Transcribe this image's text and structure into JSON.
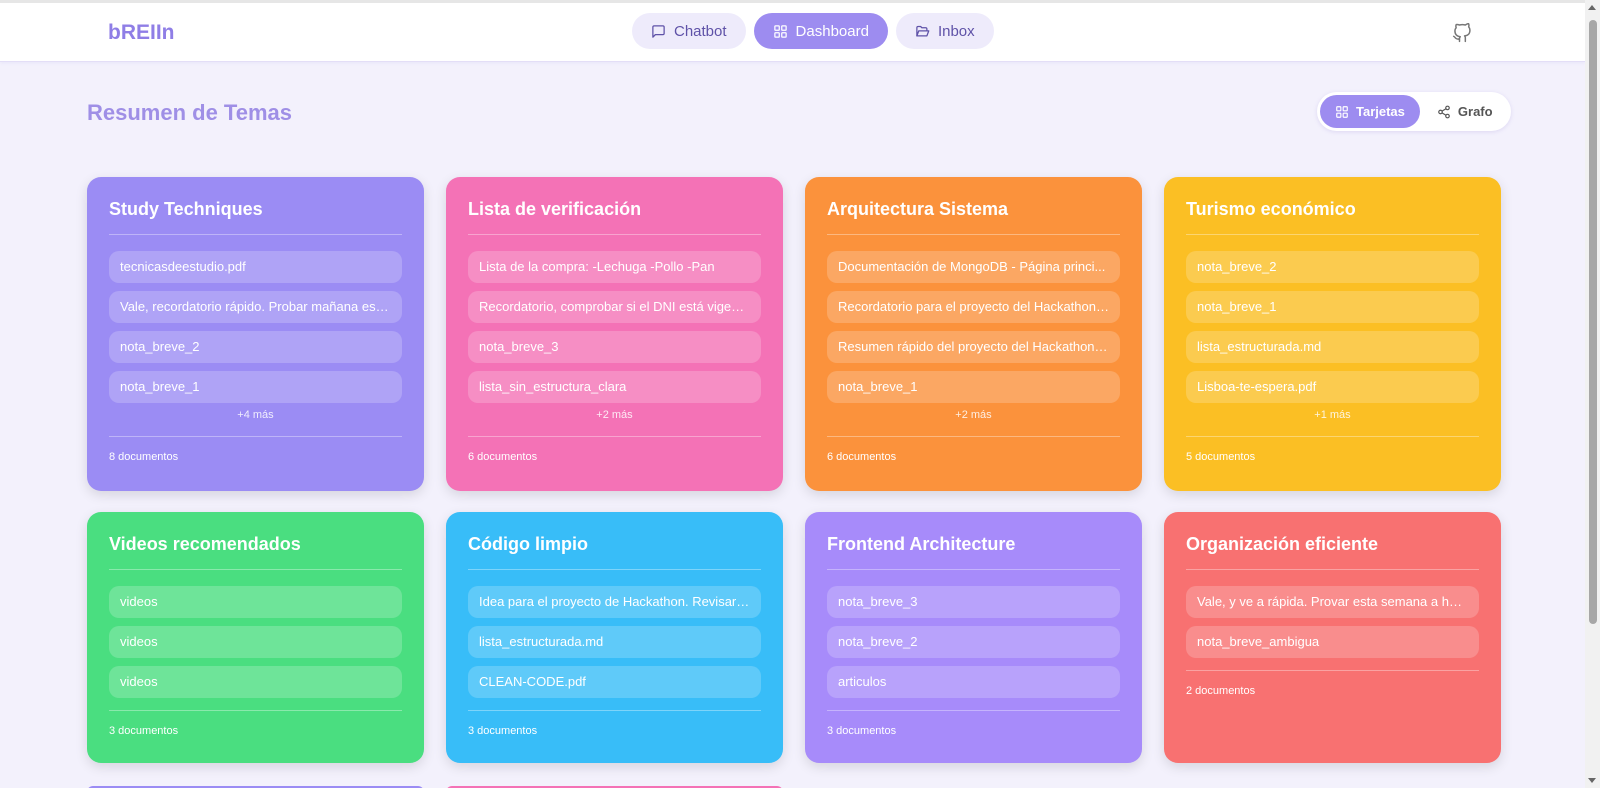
{
  "header": {
    "logo": "bREIIn",
    "nav": [
      {
        "label": "Chatbot",
        "icon": "message-square-icon",
        "active": false
      },
      {
        "label": "Dashboard",
        "icon": "layout-grid-icon",
        "active": true
      },
      {
        "label": "Inbox",
        "icon": "folder-open-icon",
        "active": false
      }
    ],
    "github_icon": "github-icon"
  },
  "page": {
    "title": "Resumen de Temas",
    "views": [
      {
        "label": "Tarjetas",
        "icon": "layout-grid-icon",
        "active": true
      },
      {
        "label": "Grafo",
        "icon": "share-icon",
        "active": false
      }
    ]
  },
  "cards": [
    {
      "title": "Study Techniques",
      "color": "#9b8cf4",
      "items": [
        "tecnicasdeestudio.pdf",
        "Vale, recordatorio rápido. Probar mañana estu...",
        "nota_breve_2",
        "nota_breve_1"
      ],
      "more": "+4 más",
      "count": "8 documentos"
    },
    {
      "title": "Lista de verificación",
      "color": "#f472b6",
      "items": [
        "Lista de la compra: -Lechuga -Pollo -Pan",
        "Recordatorio, comprobar si el DNI está vigent...",
        "nota_breve_3",
        "lista_sin_estructura_clara"
      ],
      "more": "+2 más",
      "count": "6 documentos"
    },
    {
      "title": "Arquitectura Sistema",
      "color": "#fb923c",
      "items": [
        "Documentación de MongoDB - Página princi...",
        "Recordatorio para el proyecto del Hackathon. ...",
        "Resumen rápido del proyecto del Hackathon. ...",
        "nota_breve_1"
      ],
      "more": "+2 más",
      "count": "6 documentos"
    },
    {
      "title": "Turismo económico",
      "color": "#fbbf24",
      "items": [
        "nota_breve_2",
        "nota_breve_1",
        "lista_estructurada.md",
        "Lisboa-te-espera.pdf"
      ],
      "more": "+1 más",
      "count": "5 documentos"
    },
    {
      "title": "Videos recomendados",
      "color": "#4ade80",
      "items": [
        "videos",
        "videos",
        "videos"
      ],
      "more": "",
      "count": "3 documentos"
    },
    {
      "title": "Código limpio",
      "color": "#38bdf8",
      "items": [
        "Idea para el proyecto de Hackathon. Revisar si...",
        "lista_estructurada.md",
        "CLEAN-CODE.pdf"
      ],
      "more": "",
      "count": "3 documentos"
    },
    {
      "title": "Frontend Architecture",
      "color": "#a78bfa",
      "items": [
        "nota_breve_3",
        "nota_breve_2",
        "articulos"
      ],
      "more": "",
      "count": "3 documentos"
    },
    {
      "title": "Organización eficiente",
      "color": "#f87171",
      "items": [
        "Vale, y ve a rápida. Provar esta semana a hace...",
        "nota_breve_ambigua"
      ],
      "more": "",
      "count": "2 documentos"
    }
  ]
}
